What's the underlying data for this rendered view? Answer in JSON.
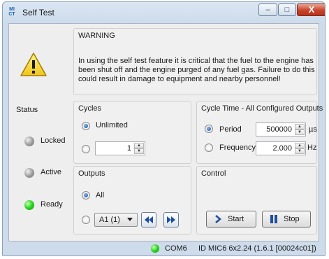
{
  "window": {
    "app_icon_text": "MICT",
    "title": "Self Test",
    "controls": {
      "minimize": "–",
      "maximize": "□",
      "close": "X"
    }
  },
  "warning": {
    "heading": "WARNING",
    "icon": "warning-icon",
    "message": "In using the self test feature it is critical that the fuel to the engine has been shut off and the engine purged of any fuel gas. Failure to do this could result in damage to equipment and nearby personnel!"
  },
  "status": {
    "heading": "Status",
    "items": [
      {
        "label": "Locked",
        "state": "off",
        "color": "#9a9a9a"
      },
      {
        "label": "Active",
        "state": "off",
        "color": "#9a9a9a"
      },
      {
        "label": "Ready",
        "state": "on",
        "color": "#27d41c"
      }
    ]
  },
  "cycles": {
    "heading": "Cycles",
    "options": [
      {
        "label": "Unlimited",
        "selected": true
      },
      {
        "label": "",
        "selected": false,
        "value": "1"
      }
    ]
  },
  "cycle_time": {
    "heading": "Cycle Time - All Configured Outputs",
    "options": [
      {
        "label": "Period",
        "selected": true,
        "value": "500000",
        "unit": "µs"
      },
      {
        "label": "Frequency",
        "selected": false,
        "value": "2.000",
        "unit": "Hz"
      }
    ]
  },
  "outputs": {
    "heading": "Outputs",
    "all_label": "All",
    "all_selected": true,
    "single_selected": false,
    "selected_output": "A1 (1)",
    "prev_icon": "rewind-icon",
    "next_icon": "fast-forward-icon"
  },
  "control": {
    "heading": "Control",
    "start_label": "Start",
    "stop_label": "Stop",
    "start_icon": "play-icon",
    "stop_icon": "pause-icon"
  },
  "statusbar": {
    "connection_color": "#27d41c",
    "port": "COM6",
    "device_info": "ID MIC6 6x2.24 (1.6.1 [00024c01])"
  }
}
